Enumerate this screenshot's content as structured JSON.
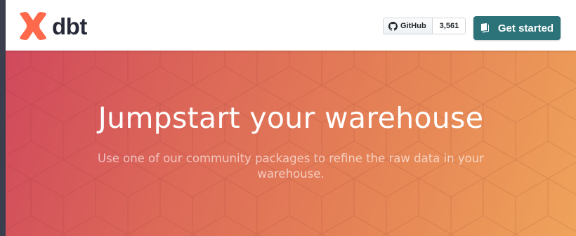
{
  "navbar": {
    "brand": "dbt",
    "github": {
      "label": "GitHub",
      "count": "3,561"
    },
    "cta_label": "Get started"
  },
  "hero": {
    "title": "Jumpstart your warehouse",
    "subtitle": "Use one of our community packages to refine the raw data in your warehouse."
  },
  "colors": {
    "brand_orange": "#ff694b",
    "cta_teal": "#2c7379",
    "hero_gradient_start": "#d0495c",
    "hero_gradient_end": "#efa35a"
  },
  "icons": [
    "dbt-logo-icon",
    "github-icon",
    "book-icon"
  ]
}
